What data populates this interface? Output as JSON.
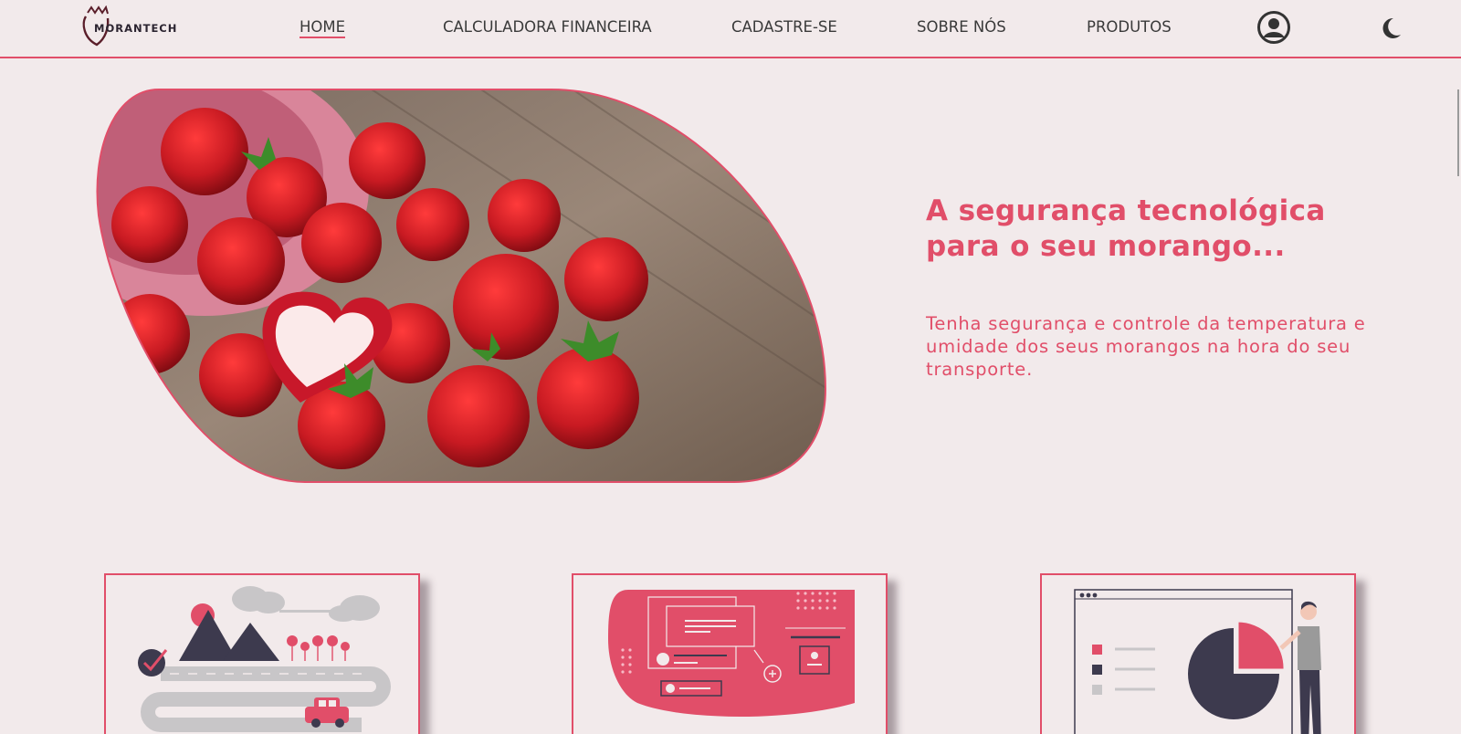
{
  "brand": {
    "logo_text": "MORANTECH",
    "accent_color": "#e14e69",
    "dark_color": "#3d3a4e"
  },
  "nav": {
    "items": [
      {
        "label": "HOME",
        "active": true
      },
      {
        "label": "CALCULADORA FINANCEIRA",
        "active": false
      },
      {
        "label": "CADASTRE-SE",
        "active": false
      },
      {
        "label": "SOBRE NÓS",
        "active": false
      },
      {
        "label": "PRODUTOS",
        "active": false
      }
    ],
    "user_icon": "user-circle-icon",
    "theme_icon": "moon-icon"
  },
  "hero": {
    "title": "A segurança tecnológica para o seu morango...",
    "text": "Tenha segurança e controle da temperatura e umidade dos seus morangos na hora do seu transporte.",
    "image": "strawberries-photo"
  },
  "cards": [
    {
      "illustration": "delivery-route-illustration"
    },
    {
      "illustration": "dashboard-interface-illustration"
    },
    {
      "illustration": "pie-chart-presentation-illustration"
    }
  ]
}
